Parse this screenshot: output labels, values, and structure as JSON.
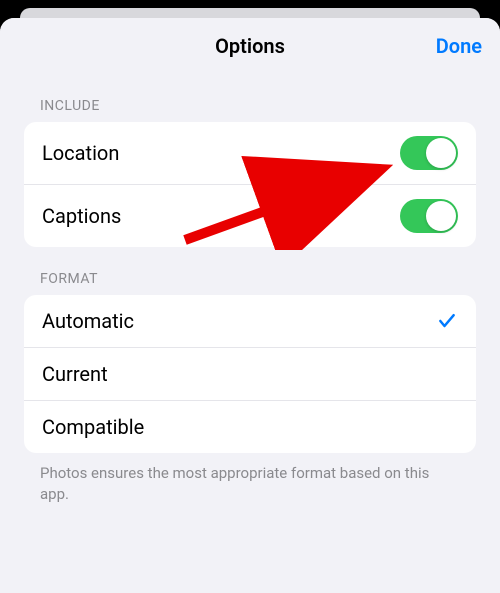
{
  "header": {
    "title": "Options",
    "done_label": "Done"
  },
  "sections": {
    "include": {
      "header": "INCLUDE",
      "rows": {
        "location": {
          "label": "Location"
        },
        "captions": {
          "label": "Captions"
        }
      }
    },
    "format": {
      "header": "FORMAT",
      "rows": {
        "automatic": {
          "label": "Automatic"
        },
        "current": {
          "label": "Current"
        },
        "compatible": {
          "label": "Compatible"
        }
      },
      "footer": "Photos ensures the most appropriate format based on this app."
    }
  }
}
